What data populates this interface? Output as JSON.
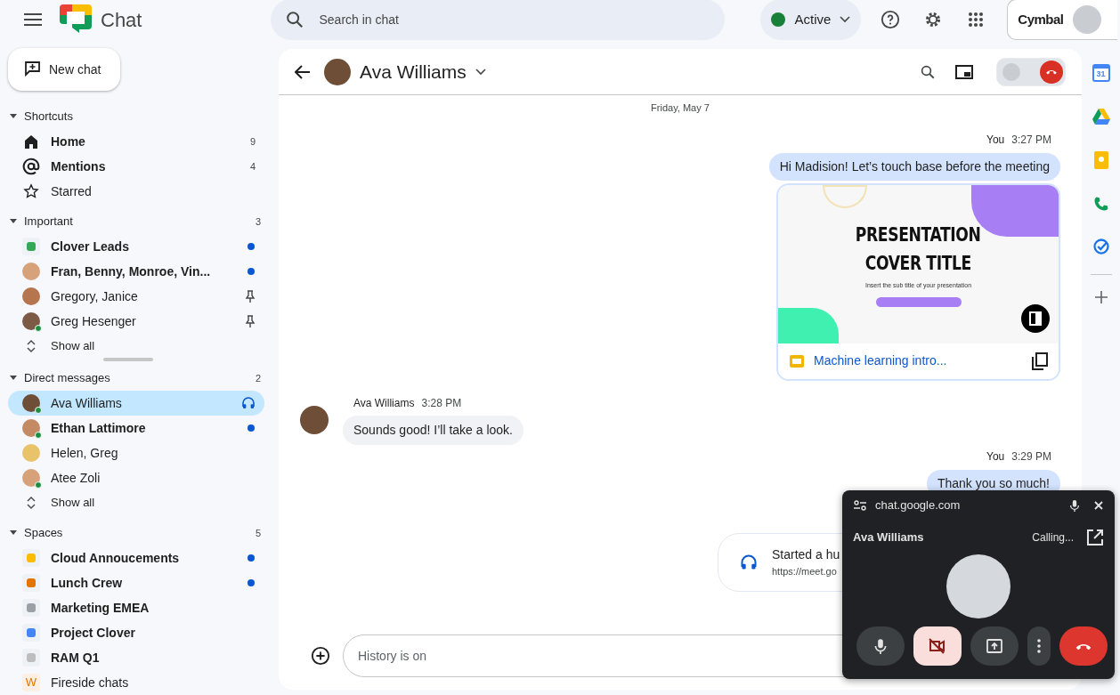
{
  "app": {
    "name": "Chat"
  },
  "new_chat": {
    "label": "New chat"
  },
  "search": {
    "placeholder": "Search in chat"
  },
  "status": {
    "label": "Active",
    "color": "#188038"
  },
  "account": {
    "org": "Cymbal"
  },
  "sidebar": {
    "sections": [
      {
        "title": "Shortcuts",
        "expanded": true,
        "items": [
          {
            "kind": "home",
            "label": "Home",
            "unread": true,
            "selected": false,
            "trailing": {
              "kind": "count",
              "count": "9"
            }
          },
          {
            "kind": "mention",
            "label": "Mentions",
            "unread": true,
            "selected": false,
            "trailing": {
              "kind": "count",
              "count": "4"
            }
          },
          {
            "kind": "star",
            "label": "Starred",
            "unread": false,
            "selected": false
          }
        ]
      },
      {
        "title": "Important",
        "count": "3",
        "expanded": true,
        "items": [
          {
            "kind": "space",
            "label": "Clover Leads",
            "unread": true,
            "selected": false,
            "trailing": {
              "kind": "dot"
            },
            "color": "#34a853"
          },
          {
            "kind": "avatar",
            "label": "Fran, Benny, Monroe, Vin...",
            "unread": true,
            "selected": false,
            "trailing": {
              "kind": "dot"
            },
            "online": false
          },
          {
            "kind": "avatar",
            "label": "Gregory, Janice",
            "unread": false,
            "selected": false,
            "trailing": {
              "kind": "pin"
            },
            "online": false
          },
          {
            "kind": "avatar",
            "label": "Greg Hesenger",
            "unread": false,
            "selected": false,
            "trailing": {
              "kind": "pin"
            },
            "online": true
          },
          {
            "kind": "show_all",
            "label": "Show all",
            "unread": false,
            "selected": false
          }
        ]
      },
      {
        "title": "Direct messages",
        "count": "2",
        "expanded": true,
        "items": [
          {
            "kind": "avatar",
            "label": "Ava Williams",
            "unread": false,
            "selected": true,
            "trailing": {
              "kind": "headset"
            },
            "online": true
          },
          {
            "kind": "avatar",
            "label": "Ethan Lattimore",
            "unread": true,
            "selected": false,
            "trailing": {
              "kind": "dot"
            },
            "online": true
          },
          {
            "kind": "avatar",
            "label": "Helen, Greg",
            "unread": false,
            "selected": false,
            "online": false
          },
          {
            "kind": "avatar",
            "label": "Atee Zoli",
            "unread": false,
            "selected": false,
            "online": true
          },
          {
            "kind": "show_all",
            "label": "Show all",
            "unread": false,
            "selected": false
          }
        ]
      },
      {
        "title": "Spaces",
        "count": "5",
        "expanded": true,
        "items": [
          {
            "kind": "space",
            "label": "Cloud Annoucements",
            "unread": true,
            "selected": false,
            "trailing": {
              "kind": "dot"
            },
            "color": "#fbbc04"
          },
          {
            "kind": "space",
            "label": "Lunch Crew",
            "unread": true,
            "selected": false,
            "trailing": {
              "kind": "dot"
            },
            "color": "#e37400"
          },
          {
            "kind": "space",
            "label": "Marketing EMEA",
            "unread": true,
            "selected": false,
            "color": "#9aa0a6"
          },
          {
            "kind": "space",
            "label": "Project Clover",
            "unread": true,
            "selected": false,
            "color": "#4285f4"
          },
          {
            "kind": "space",
            "label": "RAM Q1",
            "unread": true,
            "selected": false,
            "color": "#bdbdbd"
          },
          {
            "kind": "letter",
            "label": "Fireside chats",
            "letter": "W",
            "unread": false,
            "selected": false
          }
        ]
      }
    ]
  },
  "chat": {
    "title": "Ava Williams",
    "date": "Friday, May 7",
    "messages": [
      {
        "kind": "outgoing",
        "sender": "You",
        "time": "3:27 PM",
        "text": "Hi Madision! Let’s touch base before the meeting",
        "attachment": {
          "slide_title_lines": [
            "PRESENTATION",
            "COVER TITLE"
          ],
          "slide_subtitle": "Insert the sub title of your presentation",
          "file_name": "Machine learning intro..."
        }
      },
      {
        "kind": "incoming",
        "sender": "Ava Williams",
        "time": "3:28 PM",
        "text": "Sounds good! I’ll take a look."
      },
      {
        "kind": "outgoing",
        "sender": "You",
        "time": "3:29 PM",
        "text": "Thank you so much!"
      },
      {
        "kind": "huddle",
        "text": "Started a hu",
        "link": "https://meet.go"
      }
    ],
    "composer": {
      "placeholder": "History is on"
    }
  },
  "call_popup": {
    "site": "chat.google.com",
    "name": "Ava Williams",
    "status": "Calling...",
    "controls": [
      {
        "kind": "mic"
      },
      {
        "kind": "camera_off"
      },
      {
        "kind": "present"
      },
      {
        "kind": "more"
      },
      {
        "kind": "hangup"
      }
    ]
  },
  "rail": {
    "calendar_day": "31"
  }
}
